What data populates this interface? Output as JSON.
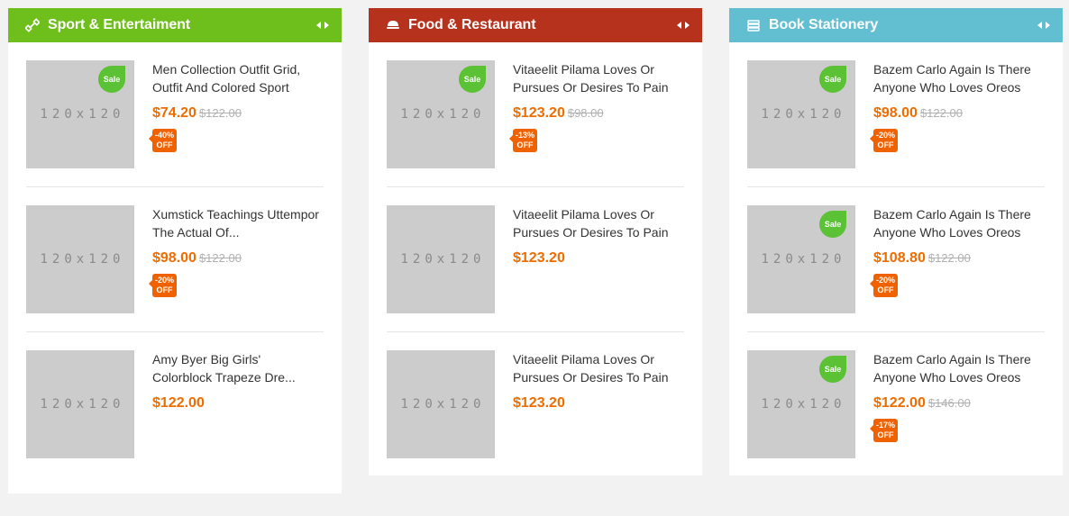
{
  "colors": {
    "sport_header": "#6fbf1c",
    "food_header": "#b7321c",
    "book_header": "#62bfd2",
    "price": "#ef6c00",
    "sale_badge": "#5bc236"
  },
  "panels": {
    "sport": {
      "title": "Sport & Entertaiment",
      "icon": "dumbbell-icon",
      "products": [
        {
          "title": "Men Collection Outfit Grid, Outfit And Colored Sport",
          "thumb": "120x120",
          "sale": "Sale",
          "price": "$74.20",
          "old_price": "$122.00",
          "discount": "-40%",
          "discount_off": "OFF"
        },
        {
          "title": "Xumstick Teachings Uttempor The Actual Of...",
          "thumb": "120x120",
          "price": "$98.00",
          "old_price": "$122.00",
          "discount": "-20%",
          "discount_off": "OFF"
        },
        {
          "title": "Amy Byer Big Girls' Colorblock Trapeze Dre...",
          "thumb": "120x120",
          "price": "$122.00"
        }
      ]
    },
    "food": {
      "title": "Food & Restaurant",
      "icon": "food-icon",
      "products": [
        {
          "title": "Vitaeelit Pilama Loves Or Pursues Or Desires To Pain",
          "thumb": "120x120",
          "sale": "Sale",
          "price": "$123.20",
          "old_price": "$98.00",
          "discount": "-13%",
          "discount_off": "OFF"
        },
        {
          "title": "Vitaeelit Pilama Loves Or Pursues Or Desires To Pain",
          "thumb": "120x120",
          "price": "$123.20"
        },
        {
          "title": "Vitaeelit Pilama Loves Or Pursues Or Desires To Pain",
          "thumb": "120x120",
          "price": "$123.20"
        }
      ]
    },
    "book": {
      "title": "Book Stationery",
      "icon": "books-icon",
      "products": [
        {
          "title": "Bazem Carlo Again Is There Anyone Who Loves Oreos",
          "thumb": "120x120",
          "sale": "Sale",
          "price": "$98.00",
          "old_price": "$122.00",
          "discount": "-20%",
          "discount_off": "OFF"
        },
        {
          "title": "Bazem Carlo Again Is There Anyone Who Loves Oreos",
          "thumb": "120x120",
          "sale": "Sale",
          "price": "$108.80",
          "old_price": "$122.00",
          "discount": "-20%",
          "discount_off": "OFF"
        },
        {
          "title": "Bazem Carlo Again Is There Anyone Who Loves Oreos",
          "thumb": "120x120",
          "sale": "Sale",
          "price": "$122.00",
          "old_price": "$146.00",
          "discount": "-17%",
          "discount_off": "OFF"
        }
      ]
    }
  }
}
